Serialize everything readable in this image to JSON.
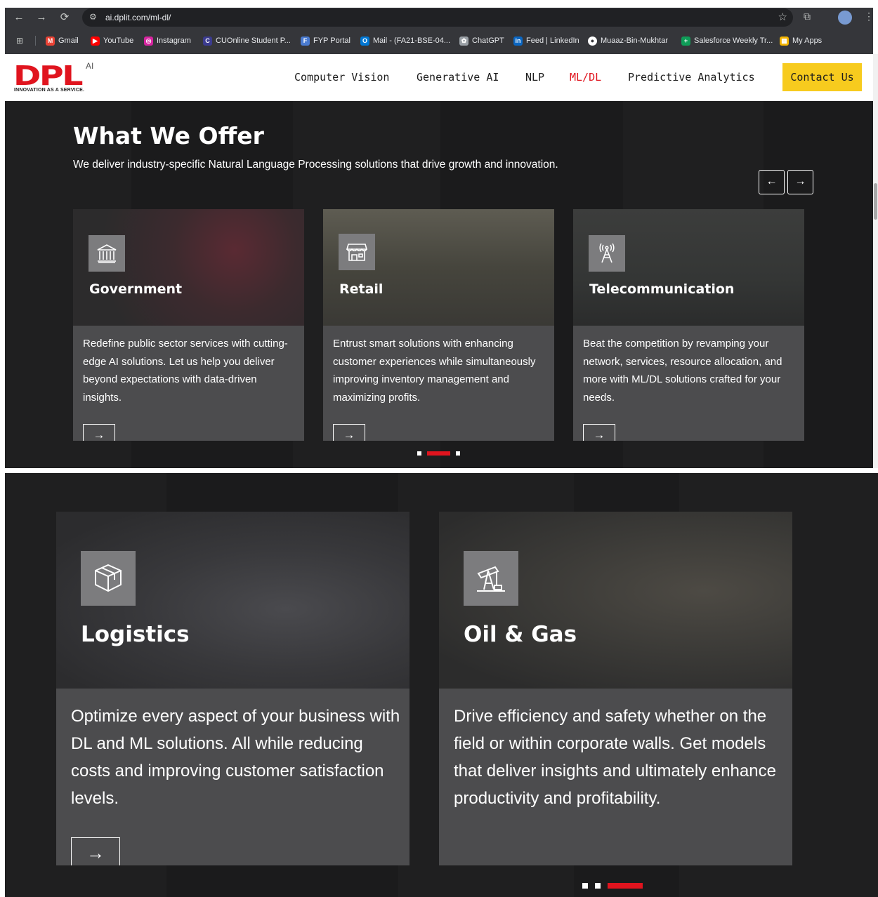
{
  "browser": {
    "url": "ai.dplit.com/ml-dl/",
    "bookmarks": [
      {
        "label": "Gmail",
        "icon": "gmail-icon",
        "color": "#ea4335"
      },
      {
        "label": "YouTube",
        "icon": "youtube-icon",
        "color": "#ff0000"
      },
      {
        "label": "Instagram",
        "icon": "instagram-icon",
        "color": "#d6249f"
      },
      {
        "label": "CUOnline Student P...",
        "icon": "cuonline-icon",
        "color": "#3b3b8f"
      },
      {
        "label": "FYP Portal",
        "icon": "fyp-portal-icon",
        "color": "#4a7bd0"
      },
      {
        "label": "Mail - (FA21-BSE-04...",
        "icon": "outlook-icon",
        "color": "#0078d4"
      },
      {
        "label": "ChatGPT",
        "icon": "chatgpt-icon",
        "color": "#9aa0a6"
      },
      {
        "label": "Feed | LinkedIn",
        "icon": "linkedin-icon",
        "color": "#0a66c2"
      },
      {
        "label": "Muaaz-Bin-Mukhtar",
        "icon": "github-icon",
        "color": "#ffffff"
      },
      {
        "label": "Salesforce Weekly Tr...",
        "icon": "sheets-icon",
        "color": "#0f9d58"
      },
      {
        "label": "My Apps",
        "icon": "my-apps-icon",
        "color": "#f4b400"
      }
    ]
  },
  "header": {
    "logo_main": "DPL",
    "logo_ai": "AI",
    "logo_tagline": "INNOVATION AS A SERVICE.",
    "nav": [
      "Computer Vision",
      "Generative AI",
      "NLP",
      "ML/DL",
      "Predictive Analytics"
    ],
    "active_nav": "ML/DL",
    "contact_label": "Contact Us",
    "accent_color": "#e0141e",
    "contact_color": "#f7cb1e"
  },
  "offer": {
    "title": "What We Offer",
    "subtitle": "We deliver industry-specific Natural Language Processing solutions that drive growth and innovation.",
    "prev_label": "←",
    "next_label": "→",
    "cards": [
      {
        "title": "Government",
        "icon": "government-building-icon",
        "text": "Redefine public sector services with cutting-edge AI solutions. Let us help you deliver beyond expectations with data-driven insights.",
        "arrow": "→"
      },
      {
        "title": "Retail",
        "icon": "store-icon",
        "text": "Entrust smart solutions with enhancing customer experiences while simultaneously improving inventory management and maximizing profits.",
        "arrow": "→"
      },
      {
        "title": "Telecommunication",
        "icon": "telecom-tower-icon",
        "text": "Beat the competition by revamping your network, services, resource allocation, and more with ML/DL solutions crafted for your needs.",
        "arrow": "→"
      }
    ],
    "carousel_active": 2
  },
  "offer_more": {
    "cards": [
      {
        "title": "Logistics",
        "icon": "package-box-icon",
        "text": "Optimize every aspect of your business with DL and ML solutions. All while reducing costs and improving customer satisfaction levels.",
        "arrow": "→"
      },
      {
        "title": "Oil & Gas",
        "icon": "oil-pump-icon",
        "text": "Drive efficiency and safety whether on the field or within corporate walls. Get models that deliver insights and ultimately enhance productivity and profitability.",
        "arrow": "→"
      }
    ],
    "carousel_active": 3
  }
}
